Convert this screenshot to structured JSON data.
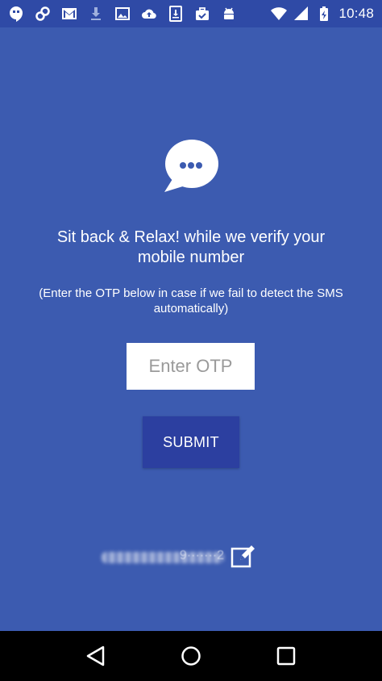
{
  "status_bar": {
    "time": "10:48",
    "icons": [
      "hangouts-icon",
      "link-icon",
      "gmail-icon",
      "download-icon",
      "image-icon",
      "cloud-upload-icon",
      "download-box-icon",
      "briefcase-icon",
      "android-icon"
    ],
    "wifi_icon": "wifi-icon",
    "signal_icon": "signal-icon",
    "battery_icon": "battery-charging-icon"
  },
  "verify": {
    "headline": "Sit back & Relax! while we verify your mobile number",
    "hint": "(Enter the OTP below in case if we fail to detect the SMS automatically)",
    "otp_placeholder": "Enter OTP",
    "otp_value": "",
    "submit_label": "SUBMIT",
    "phone_number_masked": "9·······2"
  },
  "nav": {
    "back": "back-icon",
    "home": "home-icon",
    "recents": "recents-icon"
  },
  "colors": {
    "background": "#3c5bb0",
    "status_bar": "#2f4aa6",
    "button": "#2c3fa0",
    "nav_bar": "#000000"
  }
}
